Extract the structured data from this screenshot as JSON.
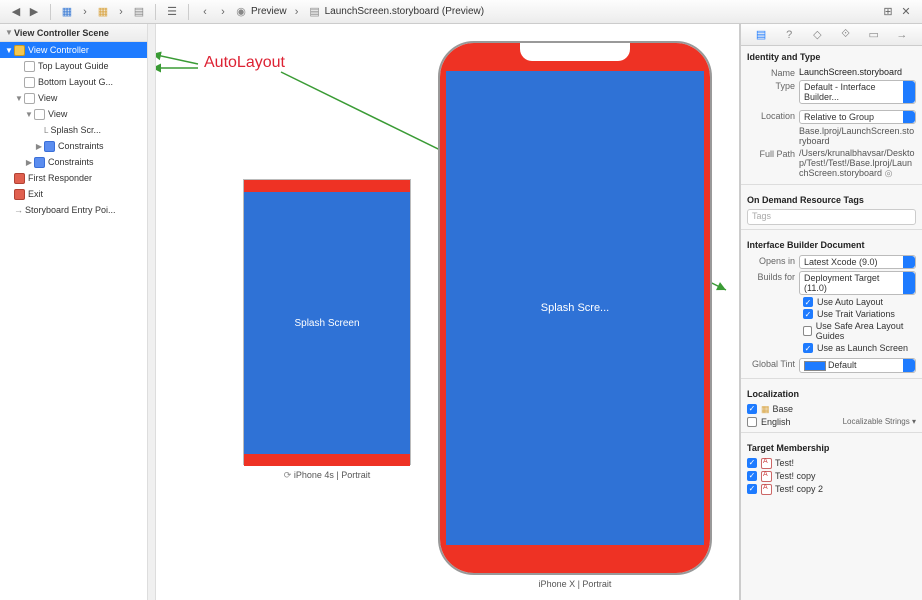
{
  "toolbar": {
    "crumb1": "Preview",
    "crumb2": "LaunchScreen.storyboard (Preview)"
  },
  "outline": {
    "header": "View Controller Scene",
    "nodes": {
      "viewController": "View Controller",
      "topGuide": "Top Layout Guide",
      "bottomGuide": "Bottom Layout G...",
      "viewOuter": "View",
      "viewInner": "View",
      "splash": "Splash Scr...",
      "constraintsInner": "Constraints",
      "constraintsOuter": "Constraints",
      "firstResponder": "First Responder",
      "exit": "Exit",
      "entryPoint": "Storyboard Entry Poi..."
    }
  },
  "annotation": "AutoLayout",
  "devices": {
    "d1": {
      "label": "Splash Screen",
      "caption": "iPhone 4s | Portrait"
    },
    "d2": {
      "label": "Splash Scre...",
      "caption": "iPhone X | Portrait"
    }
  },
  "inspector": {
    "identity": {
      "title": "Identity and Type",
      "nameLabel": "Name",
      "nameValue": "LaunchScreen.storyboard",
      "typeLabel": "Type",
      "typeValue": "Default - Interface Builder...",
      "locationLabel": "Location",
      "locationValue": "Relative to Group",
      "locationSub": "Base.lproj/LaunchScreen.storyboard",
      "fullPathLabel": "Full Path",
      "fullPathValue": "/Users/krunalbhavsar/Desktop/Test!/Test!/Base.lproj/LaunchScreen.storyboard"
    },
    "tags": {
      "title": "On Demand Resource Tags",
      "placeholder": "Tags"
    },
    "ibdoc": {
      "title": "Interface Builder Document",
      "opensLabel": "Opens in",
      "opensValue": "Latest Xcode (9.0)",
      "buildsLabel": "Builds for",
      "buildsValue": "Deployment Target (11.0)",
      "opt1": "Use Auto Layout",
      "opt2": "Use Trait Variations",
      "opt3": "Use Safe Area Layout Guides",
      "opt4": "Use as Launch Screen",
      "tintLabel": "Global Tint",
      "tintValue": "Default"
    },
    "loc": {
      "title": "Localization",
      "base": "Base",
      "english": "English",
      "englishType": "Localizable Strings"
    },
    "target": {
      "title": "Target Membership",
      "t1": "Test!",
      "t2": "Test! copy",
      "t3": "Test! copy 2"
    }
  }
}
